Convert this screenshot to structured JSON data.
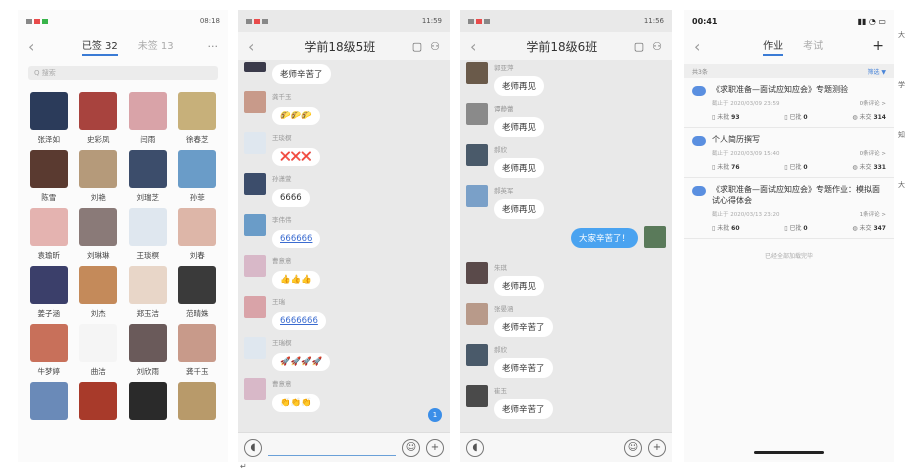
{
  "panel1": {
    "time": "08:18",
    "tabs": [
      {
        "label": "已签 32",
        "active": true
      },
      {
        "label": "未签 13",
        "active": false
      }
    ],
    "more": "···",
    "search_placeholder": "Q 搜索",
    "students": [
      {
        "name": "张泽如",
        "color": "#2b3b5a"
      },
      {
        "name": "史彩凤",
        "color": "#a8433e"
      },
      {
        "name": "闫雨",
        "color": "#d9a3a8"
      },
      {
        "name": "徐春芝",
        "color": "#c7b07a"
      },
      {
        "name": "陈雪",
        "color": "#5a3a30"
      },
      {
        "name": "刘艳",
        "color": "#b59a7a"
      },
      {
        "name": "刘瑞芝",
        "color": "#3c4d6b"
      },
      {
        "name": "孙菲",
        "color": "#6a9cc8"
      },
      {
        "name": "袁瑜昕",
        "color": "#e4b3b0"
      },
      {
        "name": "刘琳琳",
        "color": "#8a7a78"
      },
      {
        "name": "王琰榠",
        "color": "#dfe7ef"
      },
      {
        "name": "刘春",
        "color": "#ddb6a8"
      },
      {
        "name": "姜子涵",
        "color": "#3b3f6a"
      },
      {
        "name": "刘杰",
        "color": "#c48a5a"
      },
      {
        "name": "郑玉洁",
        "color": "#e8d6c8"
      },
      {
        "name": "范晴姝",
        "color": "#3a3a3a"
      },
      {
        "name": "牛梦婷",
        "color": "#c8705a"
      },
      {
        "name": "曲洁",
        "color": "#f5f5f5"
      },
      {
        "name": "刘欣雨",
        "color": "#6a5a5a"
      },
      {
        "name": "龚千玉",
        "color": "#c89a8a"
      },
      {
        "name": "",
        "color": "#6a8ab8"
      },
      {
        "name": "",
        "color": "#a83a2a"
      },
      {
        "name": "",
        "color": "#2a2a2a"
      },
      {
        "name": "",
        "color": "#b89a6a"
      }
    ]
  },
  "panel2": {
    "time": "11:59",
    "title": "学前18级5班",
    "first_bubble": "老师辛苦了",
    "messages": [
      {
        "sender": "龚千玉",
        "text": "🌮🌮🌮",
        "color": "#c89a8a",
        "link": false
      },
      {
        "sender": "王琰榠",
        "text": "❌❌❌",
        "color": "#dfe7ef",
        "link": false
      },
      {
        "sender": "孙潇萱",
        "text": "6666",
        "color": "#3c4d6b",
        "link": false
      },
      {
        "sender": "李伟伟",
        "text": "666666",
        "color": "#6a9cc8",
        "link": true
      },
      {
        "sender": "曹意意",
        "text": "👍👍👍",
        "color": "#d8b8c8",
        "link": false
      },
      {
        "sender": "王瑞",
        "text": "6666666",
        "color": "#d9a3a8",
        "link": true
      },
      {
        "sender": "王瑞榠",
        "text": "🚀🚀🚀🚀",
        "color": "#dfe7ef",
        "link": false
      },
      {
        "sender": "曹意意",
        "text": "👏👏👏",
        "color": "#d8b8c8",
        "link": false
      }
    ],
    "badge": "1"
  },
  "panel3": {
    "time": "11:56",
    "title": "学前18级6班",
    "messages_top": [
      {
        "sender": "郭亚萍",
        "text": "老师再见",
        "color": "#6a5a4a"
      },
      {
        "sender": "谭静蕾",
        "text": "老师再见",
        "color": "#8a8a8a"
      },
      {
        "sender": "郝欣",
        "text": "老师再见",
        "color": "#4a5a6a"
      },
      {
        "sender": "郝英军",
        "text": "老师再见",
        "color": "#7aa0c8"
      }
    ],
    "self_message": "大家辛苦了！",
    "messages_bottom": [
      {
        "sender": "朱琪",
        "text": "老师再见",
        "color": "#5a4a4a"
      },
      {
        "sender": "张晏涵",
        "text": "老师辛苦了",
        "color": "#b89a8a"
      },
      {
        "sender": "郝欣",
        "text": "老师辛苦了",
        "color": "#4a5a6a"
      },
      {
        "sender": "崔玉",
        "text": "老师辛苦了",
        "color": "#4a4a4a"
      }
    ]
  },
  "panel4": {
    "time": "00:41",
    "tabs": [
      {
        "label": "作业",
        "active": true
      },
      {
        "label": "考试",
        "active": false
      }
    ],
    "add": "+",
    "filter_left": "共3条",
    "filter_right": "筛选 ▼",
    "items": [
      {
        "title": "《求职准备—面试应知应会》专题测验",
        "deadline": "截止于 2020/03/09 23:59",
        "comments": "0条评论 >",
        "submitted_label": "未批",
        "submitted": "93",
        "graded_label": "已批",
        "graded": "0",
        "unsubmitted_label": "未交",
        "unsubmitted": "314"
      },
      {
        "title": "个人简历撰写",
        "deadline": "截止于 2020/03/09 15:40",
        "comments": "0条评论 >",
        "submitted_label": "未批",
        "submitted": "76",
        "graded_label": "已批",
        "graded": "0",
        "unsubmitted_label": "未交",
        "unsubmitted": "331"
      },
      {
        "title": "《求职准备—面试应知应会》专题作业：模拟面试心得体会",
        "deadline": "截止于 2020/03/13 23:20",
        "comments": "1条评论 >",
        "submitted_label": "未批",
        "submitted": "60",
        "graded_label": "已批",
        "graded": "0",
        "unsubmitted_label": "未交",
        "unsubmitted": "347"
      }
    ],
    "end_note": "已经全部加载完毕"
  },
  "edge_chars": [
    "大",
    "学",
    "知",
    "大"
  ],
  "caret": "↵"
}
